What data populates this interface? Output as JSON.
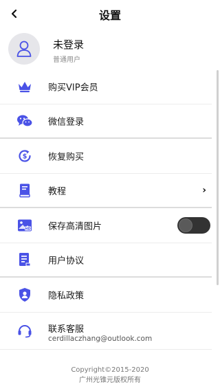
{
  "header": {
    "title": "设置",
    "back_icon": "chevron-left-icon"
  },
  "profile": {
    "name": "未登录",
    "subtitle": "普通用户",
    "avatar_icon": "user-icon"
  },
  "accent_color": "#4a52e6",
  "menu": [
    {
      "label": "购买VIP会员",
      "icon": "crown-icon"
    },
    {
      "label": "微信登录",
      "icon": "wechat-icon"
    },
    {
      "label": "恢复购买",
      "icon": "restore-purchase-icon"
    },
    {
      "label": "教程",
      "icon": "book-icon",
      "chevron": "›"
    },
    {
      "label": "保存高清图片",
      "icon": "hd-image-icon",
      "toggle_on": false
    },
    {
      "label": "用户协议",
      "icon": "document-icon"
    },
    {
      "label": "隐私政策",
      "icon": "shield-user-icon"
    },
    {
      "label": "联系客服",
      "sub": "cerdillaczhang@outlook.com",
      "icon": "headset-icon"
    }
  ],
  "footer": {
    "line1": "Copyright©2015-2020",
    "line2": "广州光锥元版权所有"
  }
}
